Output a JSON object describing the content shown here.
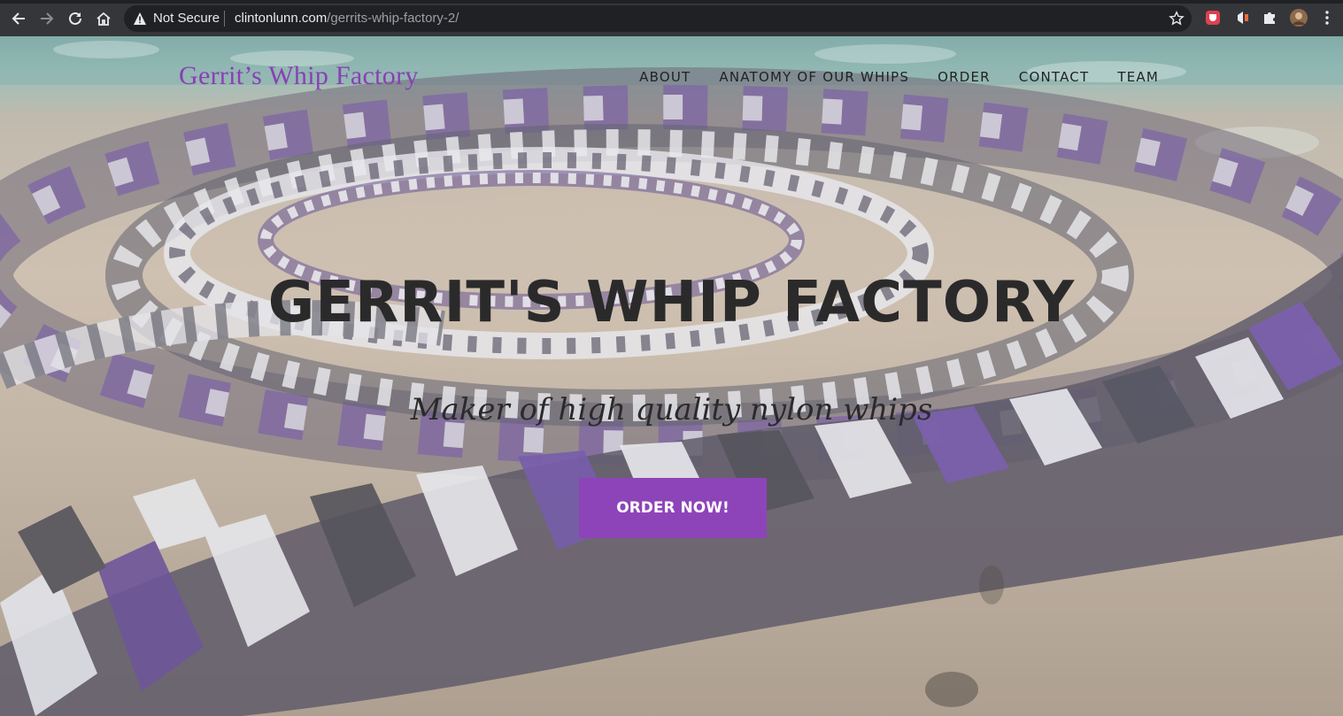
{
  "browser": {
    "security_label": "Not Secure",
    "url_host": "clintonlunn.com",
    "url_path": "/gerrits-whip-factory-2/",
    "icons": [
      "back-icon",
      "forward-icon",
      "reload-icon",
      "home-icon",
      "warning-icon",
      "star-icon",
      "shield-extension-icon",
      "extension-icon",
      "puzzle-icon",
      "avatar",
      "menu-dots-icon"
    ]
  },
  "site": {
    "logo": "Gerrit’s Whip Factory",
    "nav": [
      "ABOUT",
      "ANATOMY OF OUR WHIPS",
      "ORDER",
      "CONTACT",
      "TEAM"
    ]
  },
  "hero": {
    "title": "GERRIT'S WHIP FACTORY",
    "subtitle": "Maker of high quality nylon whips",
    "cta": "ORDER NOW!"
  },
  "colors": {
    "brand_purple": "#8e44b9",
    "logo_purple": "#8a3fb6",
    "chrome_bg": "#35363a",
    "omnibox_bg": "#202124"
  }
}
